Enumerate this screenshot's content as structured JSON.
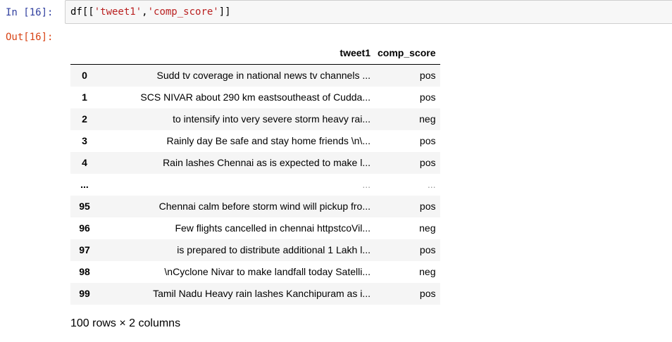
{
  "cell": {
    "in_prompt": "In [16]:",
    "out_prompt": "Out[16]:",
    "code_prefix": "df[[",
    "code_str1": "'tweet1'",
    "code_comma": ",",
    "code_str2": "'comp_score'",
    "code_suffix": "]]"
  },
  "table": {
    "columns": [
      "",
      "tweet1",
      "comp_score"
    ],
    "rows": [
      {
        "index": "0",
        "tweet1": "Sudd tv coverage in national news tv channels ...",
        "comp_score": "pos"
      },
      {
        "index": "1",
        "tweet1": "SCS NIVAR about 290 km eastsoutheast of Cudda...",
        "comp_score": "pos"
      },
      {
        "index": "2",
        "tweet1": "to intensify into very severe storm heavy rai...",
        "comp_score": "neg"
      },
      {
        "index": "3",
        "tweet1": "Rainly day Be safe and stay home friends \\n\\...",
        "comp_score": "pos"
      },
      {
        "index": "4",
        "tweet1": "Rain lashes Chennai as is expected to make l...",
        "comp_score": "pos"
      },
      {
        "index": "...",
        "tweet1": "...",
        "comp_score": "..."
      },
      {
        "index": "95",
        "tweet1": "Chennai calm before storm wind will pickup fro...",
        "comp_score": "pos"
      },
      {
        "index": "96",
        "tweet1": "Few flights cancelled in chennai httpstcoVil...",
        "comp_score": "neg"
      },
      {
        "index": "97",
        "tweet1": "is prepared to distribute additional 1 Lakh l...",
        "comp_score": "pos"
      },
      {
        "index": "98",
        "tweet1": "\\nCyclone Nivar to make landfall today Satelli...",
        "comp_score": "neg"
      },
      {
        "index": "99",
        "tweet1": "Tamil Nadu Heavy rain lashes Kanchipuram as i...",
        "comp_score": "pos"
      }
    ]
  },
  "shape_info": "100 rows × 2 columns"
}
